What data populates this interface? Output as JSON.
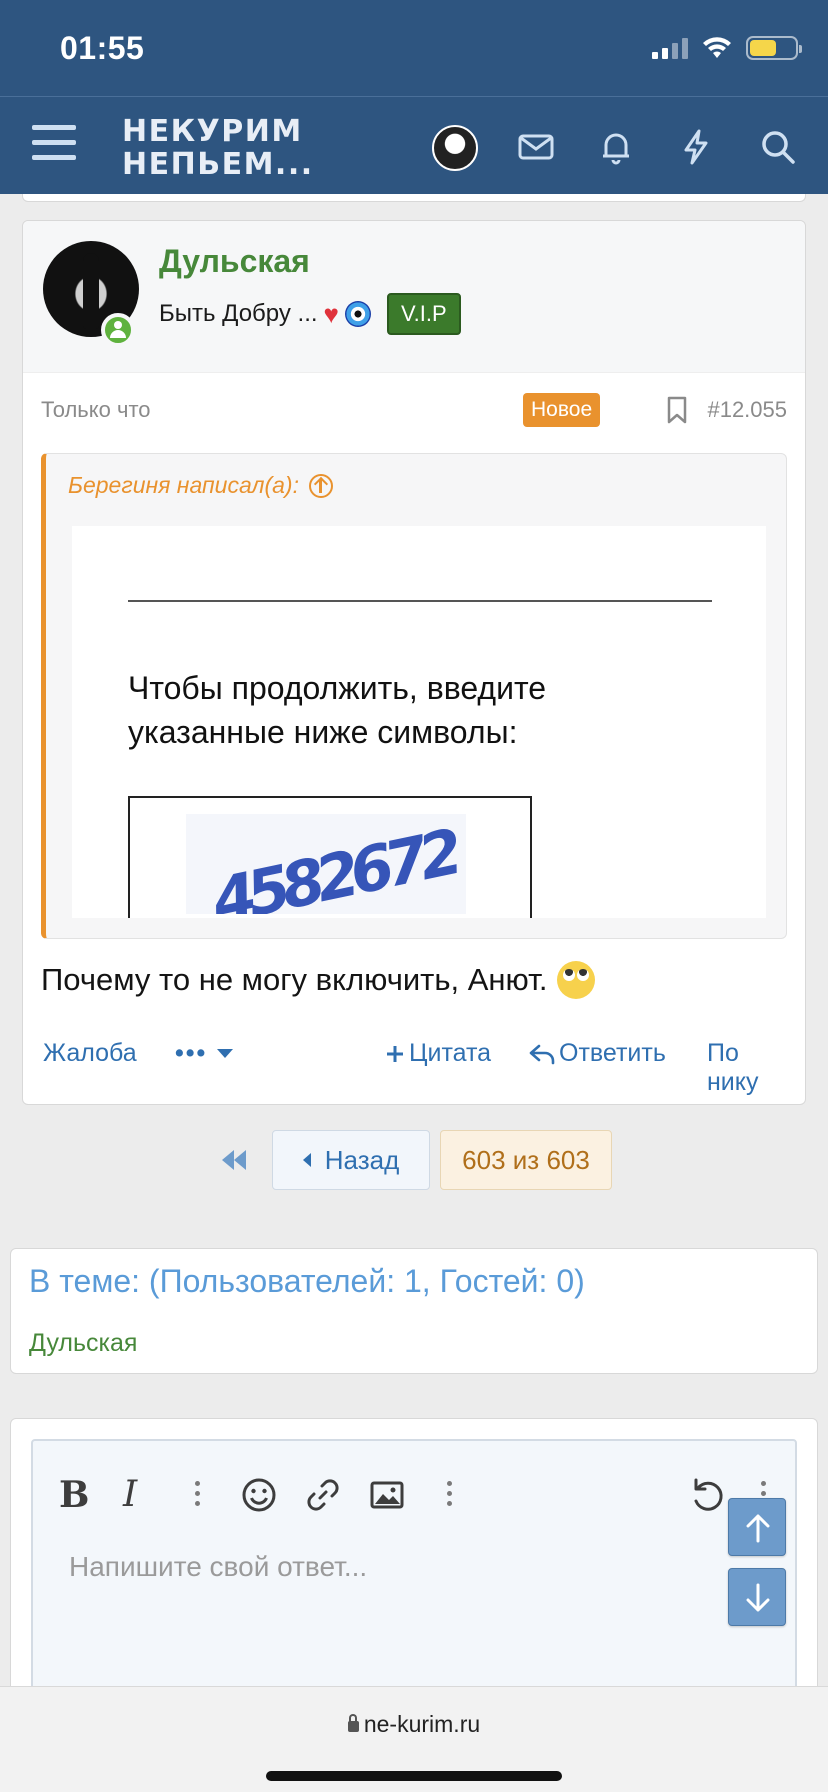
{
  "status_bar": {
    "time": "01:55",
    "battery_level": 0.6
  },
  "navbar": {
    "logo_line1": "НЕКУРИМ",
    "logo_line2": "НЕПЬЕМ...",
    "icons": [
      "menu-icon",
      "avatar",
      "envelope-icon",
      "bell-icon",
      "lightning-icon",
      "search-icon"
    ]
  },
  "post": {
    "username": "Дульская",
    "user_title": "Быть Добру ...",
    "badge": "V.I.P",
    "time": "Только что",
    "new_label": "Новое",
    "number": "#12.055",
    "quote": {
      "author": "Берегиня написал(а):",
      "image_text": "Чтобы продолжить, введите указанные ниже символы:",
      "captcha": "4582672"
    },
    "text": "Почему то не могу включить, Анют.",
    "actions": {
      "report": "Жалоба",
      "more": "•••",
      "quote": "Цитата",
      "reply": "Ответить",
      "by_nick": "По нику"
    }
  },
  "pagination": {
    "back_label": "Назад",
    "current": "603 из 603"
  },
  "online": {
    "title": "В теме: (Пользователей: 1, Гостей: 0)",
    "user": "Дульская"
  },
  "editor": {
    "placeholder": "Напишите свой ответ..."
  },
  "browser": {
    "url": "ne-kurim.ru"
  },
  "colors": {
    "header": "#2e5580",
    "username": "#47883a",
    "accent_orange": "#e9922e",
    "link_blue": "#2f6fb0",
    "vip_green": "#3b7a2b"
  }
}
